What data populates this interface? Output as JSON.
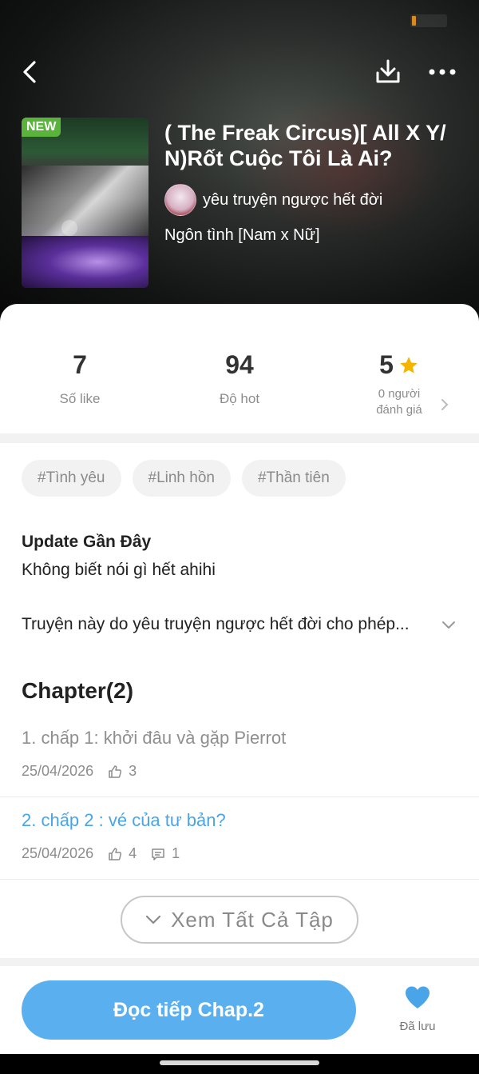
{
  "colors": {
    "accent": "#5ab0ef",
    "chapter_link": "#4aa4e8",
    "star": "#f4b400",
    "heart": "#4aa4e8",
    "new_badge": "#5ab33b"
  },
  "header": {
    "new_badge": "NEW",
    "title": "( The Freak Circus)[ All X Y/ N)Rốt Cuộc Tôi Là Ai?",
    "author": "yêu truyện ngược hết đời",
    "genre": "Ngôn tình [Nam x Nữ]",
    "icons": [
      "back-icon",
      "download-icon",
      "more-icon"
    ]
  },
  "stats": {
    "likes": {
      "value": "7",
      "label": "Số like"
    },
    "hot": {
      "value": "94",
      "label": "Độ hot"
    },
    "rating": {
      "value": "5",
      "label_line1": "0 người",
      "label_line2": "đánh giá"
    }
  },
  "tags": [
    "#Tình yêu",
    "#Linh hồn",
    "#Thần tiên"
  ],
  "update": {
    "heading": "Update Gần Đây",
    "text": "Không biết nói gì hết ahihi"
  },
  "description": "Truyện này do yêu truyện ngược hết đời cho phép...",
  "chapters": {
    "heading": "Chapter(2)",
    "items": [
      {
        "title": "1. chấp 1: khởi đâu và gặp Pierrot",
        "date": "25/04/2026",
        "likes": "3",
        "comments": ""
      },
      {
        "title": "2. chấp 2 : vé của tư bản?",
        "date": "25/04/2026",
        "likes": "4",
        "comments": "1"
      }
    ],
    "see_all": "Xem Tất Cả Tập"
  },
  "bottom": {
    "read_button": "Đọc tiếp Chap.2",
    "saved_label": "Đã lưu"
  }
}
